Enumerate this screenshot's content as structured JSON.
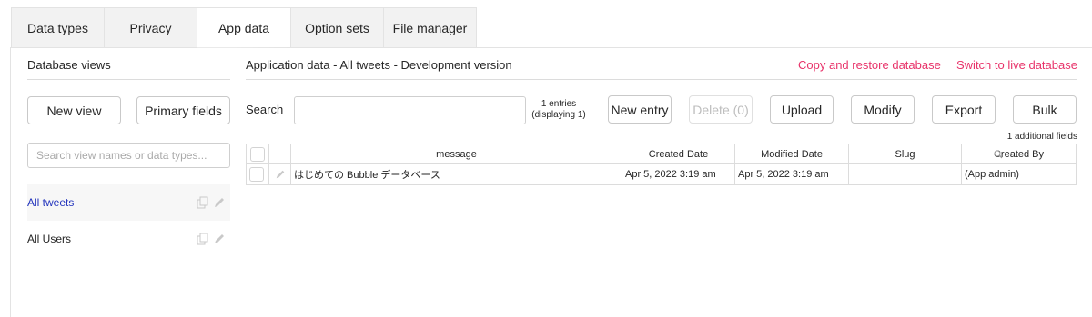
{
  "tabs": [
    {
      "label": "Data types"
    },
    {
      "label": "Privacy"
    },
    {
      "label": "App data"
    },
    {
      "label": "Option sets"
    },
    {
      "label": "File manager"
    }
  ],
  "active_tab": "App data",
  "left_panel": {
    "title": "Database views",
    "new_view_label": "New view",
    "primary_fields_label": "Primary fields",
    "search_placeholder": "Search view names or data types...",
    "views": [
      {
        "label": "All tweets",
        "selected": true
      },
      {
        "label": "All Users",
        "selected": false
      }
    ]
  },
  "main": {
    "title": "Application data - All tweets - Development version",
    "copy_restore_label": "Copy and restore database",
    "switch_live_label": "Switch to live database",
    "search_label": "Search",
    "entries_line1": "1 entries",
    "entries_line2": "(displaying 1)",
    "buttons": {
      "new_entry": "New entry",
      "delete": "Delete (0)",
      "upload": "Upload",
      "modify": "Modify",
      "export": "Export",
      "bulk": "Bulk"
    },
    "additional_fields": "1 additional fields"
  },
  "table": {
    "headers": {
      "message": "message",
      "created": "Created Date",
      "modified": "Modified Date",
      "slug": "Slug",
      "created_by": "Created By"
    },
    "rows": [
      {
        "message": "はじめての Bubble データベース",
        "created": "Apr 5, 2022 3:19 am",
        "modified": "Apr 5, 2022 3:19 am",
        "slug": "",
        "created_by": "(App admin)"
      }
    ]
  },
  "colors": {
    "accent_link": "#e8336a",
    "selected_view": "#2334bd"
  },
  "icons": [
    "copy-icon",
    "pencil-icon",
    "search-icon"
  ]
}
